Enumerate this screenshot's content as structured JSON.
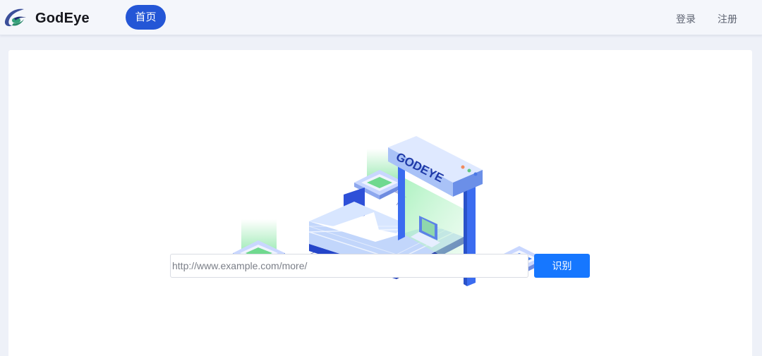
{
  "header": {
    "brand": "GodEye",
    "logo_icon": "godeye-swirl-logo",
    "nav_home": "首页",
    "login": "登录",
    "register": "注册"
  },
  "main": {
    "illustration": {
      "gate_text": "GODEYE",
      "icon": "security-gateway-illustration"
    },
    "url_input": {
      "value": "",
      "placeholder": "http://www.example.com/more/"
    },
    "submit_label": "识别"
  },
  "colors": {
    "accent": "#2456d6",
    "button": "#1677ff",
    "background": "#eef1f8"
  }
}
